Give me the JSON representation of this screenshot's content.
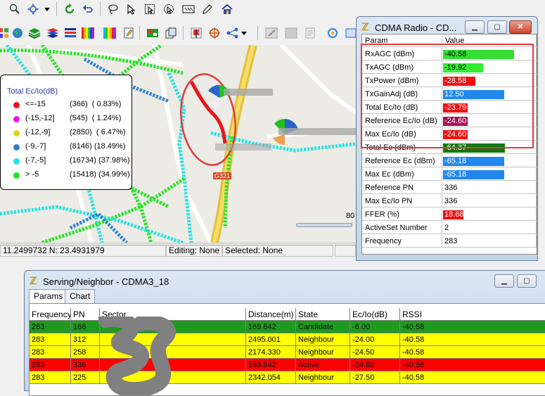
{
  "toolbar": {
    "row1_icons": [
      "zoom-icon",
      "pan-icon",
      "dropdown-icon",
      "refresh-icon",
      "undo-icon",
      "lasso-icon",
      "select-icon",
      "select-area-icon",
      "select-polygon-icon",
      "ruler-icon",
      "edit-icon",
      "home-icon"
    ],
    "row2_icons": [
      "grid-icon",
      "globe-icon",
      "layers-icon",
      "stack-icon",
      "color-bars-icon",
      "edit-doc-icon",
      "export-icon",
      "copy-icon",
      "flag-icon",
      "target-icon",
      "network-icon",
      "pen-icon",
      "doc-icon",
      "camera-icon"
    ]
  },
  "map": {
    "legend": {
      "title": "Total Ec/Io(dB)",
      "items": [
        {
          "range": "<=-15",
          "count": "(366)  ( 0.83%)",
          "color": "#e8161b"
        },
        {
          "range": "(-15,-12]",
          "count": "(545)  ( 1.24%)",
          "color": "#e619e6"
        },
        {
          "range": "(-12,-9]",
          "count": "(2850)  ( 6.47%)",
          "color": "#e8d319"
        },
        {
          "range": "(-9,-7]",
          "count": "(8146) (18.49%)",
          "color": "#2a7fd2"
        },
        {
          "range": "(-7,-5]",
          "count": "(16734) (37.98%)",
          "color": "#21e3e3"
        },
        {
          "range": "> -5",
          "count": "(15418) (34.99%)",
          "color": "#22e422"
        }
      ]
    },
    "road_label": "G321",
    "scale_label": "80"
  },
  "statusbar": {
    "coords": "11.2499732 N: 23.4931979",
    "editing": "Editing: None",
    "selected": "Selected: None"
  },
  "cdma_radio": {
    "title": "CDMA Radio - CD...",
    "header": {
      "param": "Param",
      "value": "Value"
    },
    "rows": [
      {
        "param": "RxAGC (dBm)",
        "value": "-40.58",
        "bar_color": "#33dd33",
        "fill": 0.78
      },
      {
        "param": "TxAGC (dBm)",
        "value": "-19.92",
        "bar_color": "#33ee33",
        "fill": 0.44
      },
      {
        "param": "TxPower (dBm)",
        "value": "-28.58",
        "bar_color": "#ee1111",
        "fill": 0.35
      },
      {
        "param": "TxGainAdj (dB)",
        "value": "12.50",
        "bar_color": "#2288ee",
        "fill": 0.67
      },
      {
        "param": "Total Ec/Io (dB)",
        "value": "-23.79",
        "bar_color": "#ee1111",
        "fill": 0.27
      },
      {
        "param": "Reference Ec/Io (dB)",
        "value": "-24.60",
        "bar_color": "#aa1155",
        "fill": 0.27
      },
      {
        "param": "Max Ec/Io (dB)",
        "value": "-24.60",
        "bar_color": "#ee1111",
        "fill": 0.27
      },
      {
        "param": "Total Ec (dBm)",
        "value": "-64.37",
        "bar_color": "#117711",
        "fill": 0.68
      },
      {
        "param": "Reference Ec (dBm)",
        "value": "-65.18",
        "bar_color": "#2288ee",
        "fill": 0.67
      },
      {
        "param": "Max Ec (dBm)",
        "value": "-65.18",
        "bar_color": "#2288ee",
        "fill": 0.67
      },
      {
        "param": "Reference PN",
        "value": "336",
        "bar_color": "",
        "fill": 0
      },
      {
        "param": "Max Ec/Io PN",
        "value": "336",
        "bar_color": "",
        "fill": 0
      },
      {
        "param": "FFER (%)",
        "value": "18.68",
        "bar_color": "#ee1111",
        "fill": 0.22
      },
      {
        "param": "ActiveSet Number",
        "value": "2",
        "bar_color": "",
        "fill": 0
      },
      {
        "param": "Frequency",
        "value": "283",
        "bar_color": "",
        "fill": 0
      }
    ]
  },
  "serving_neighbor": {
    "title": "Serving/Neighbor - CDMA3_18",
    "tabs": [
      "Params",
      "Chart"
    ],
    "columns": [
      "Frequency",
      "PN",
      "Sector",
      "Distance(m)",
      "State",
      "Ec/Io(dB)",
      "RSSI"
    ],
    "rows": [
      {
        "frequency": "283",
        "pn": "168",
        "sector": "",
        "distance": "169.842",
        "state": "Candidate",
        "ecio": "-6.00",
        "rssi": "-40.58",
        "bg": "#1e9a1e"
      },
      {
        "frequency": "283",
        "pn": "312",
        "sector": "",
        "distance": "2495.001",
        "state": "Neighbour",
        "ecio": "-24.00",
        "rssi": "-40.58",
        "bg": "#ffff00"
      },
      {
        "frequency": "283",
        "pn": "258",
        "sector": "",
        "distance": "2174.330",
        "state": "Neighbour",
        "ecio": "-24.50",
        "rssi": "-40.58",
        "bg": "#ffff00"
      },
      {
        "frequency": "283",
        "pn": "336",
        "sector": "",
        "distance": "169.842",
        "state": "Active",
        "ecio": "-24.60",
        "rssi": "-40.58",
        "bg": "#ff0000"
      },
      {
        "frequency": "283",
        "pn": "225",
        "sector": "",
        "distance": "2342.054",
        "state": "Neighbour",
        "ecio": "-27.50",
        "rssi": "-40.58",
        "bg": "#ffff00"
      }
    ]
  }
}
